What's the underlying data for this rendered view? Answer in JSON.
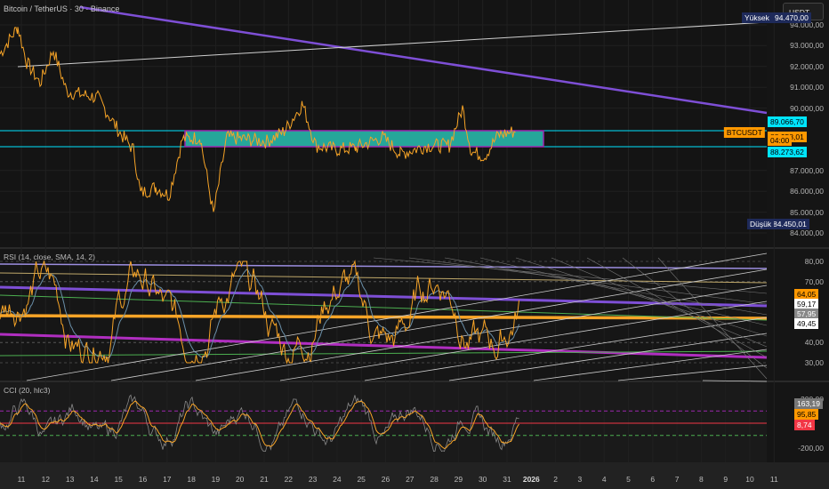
{
  "header": {
    "title": "Bitcoin / TetherUS · 30 · Binance",
    "currency": "USDT"
  },
  "price_axis": {
    "labels": [
      "94.000,00",
      "93.000,00",
      "92.000,00",
      "91.000,00",
      "90.000,00",
      "87.000,00",
      "86.000,00",
      "85.000,00",
      "84.000,00"
    ],
    "values": [
      94000,
      93000,
      92000,
      91000,
      90000,
      87000,
      86000,
      85000,
      84000
    ],
    "high_label": "Yüksek",
    "high_value": "94.470,00",
    "low_label": "Düşük",
    "low_value": "84.450,01",
    "zone_top": "89.066,70",
    "zone_bottom": "88.273,62",
    "symbol": "BTCUSDT",
    "last_price": "88.958,01",
    "countdown": "04:00"
  },
  "rsi": {
    "title": "RSI (14, close, SMA, 14, 2)",
    "labels": [
      "80,00",
      "70,00",
      "40,00",
      "30,00"
    ],
    "values": [
      80,
      70,
      40,
      30
    ],
    "tags": [
      {
        "text": "64,05",
        "value": 64.05,
        "bg": "#ff9800",
        "fg": "#000"
      },
      {
        "text": "59,17",
        "value": 59.17,
        "bg": "#ffffff",
        "fg": "#000"
      },
      {
        "text": "57,95",
        "value": 57.95,
        "bg": "#888888",
        "fg": "#fff"
      },
      {
        "text": "49,45",
        "value": 49.45,
        "bg": "#ffffff",
        "fg": "#000"
      }
    ]
  },
  "cci": {
    "title": "CCI (20, hlc3)",
    "labels": [
      "200,00",
      "-200,00"
    ],
    "tags": [
      {
        "text": "163,19",
        "bg": "#777777",
        "fg": "#fff"
      },
      {
        "text": "95,85",
        "bg": "#ff9800",
        "fg": "#000"
      },
      {
        "text": "8,74",
        "bg": "#f23645",
        "fg": "#fff"
      }
    ]
  },
  "time_axis": [
    "11",
    "12",
    "13",
    "14",
    "15",
    "16",
    "17",
    "18",
    "19",
    "20",
    "21",
    "22",
    "23",
    "24",
    "25",
    "26",
    "27",
    "28",
    "29",
    "30",
    "31",
    "2026",
    "2",
    "3",
    "4",
    "5",
    "6",
    "7",
    "8",
    "9",
    "10",
    "11"
  ],
  "colors": {
    "price": "#f7a427",
    "trend": "#7e4fd6",
    "zone": "#26a69a",
    "zone_border": "#9c27b0",
    "cyan": "#00e5ff",
    "bg": "#151515"
  },
  "price_keypoints": [
    [
      0,
      92600
    ],
    [
      20,
      93900
    ],
    [
      30,
      92200
    ],
    [
      45,
      91200
    ],
    [
      60,
      92800
    ],
    [
      75,
      90800
    ],
    [
      110,
      90500
    ],
    [
      135,
      88800
    ],
    [
      150,
      88000
    ],
    [
      158,
      85900
    ],
    [
      175,
      86200
    ],
    [
      190,
      85800
    ],
    [
      205,
      88500
    ],
    [
      225,
      88600
    ],
    [
      240,
      84900
    ],
    [
      255,
      88600
    ],
    [
      300,
      88400
    ],
    [
      320,
      88900
    ],
    [
      340,
      90200
    ],
    [
      355,
      88200
    ],
    [
      380,
      88000
    ],
    [
      400,
      88100
    ],
    [
      430,
      88600
    ],
    [
      450,
      87800
    ],
    [
      480,
      88200
    ],
    [
      505,
      88200
    ],
    [
      520,
      90000
    ],
    [
      530,
      87900
    ],
    [
      545,
      87700
    ],
    [
      560,
      88700
    ],
    [
      580,
      88900
    ]
  ]
}
